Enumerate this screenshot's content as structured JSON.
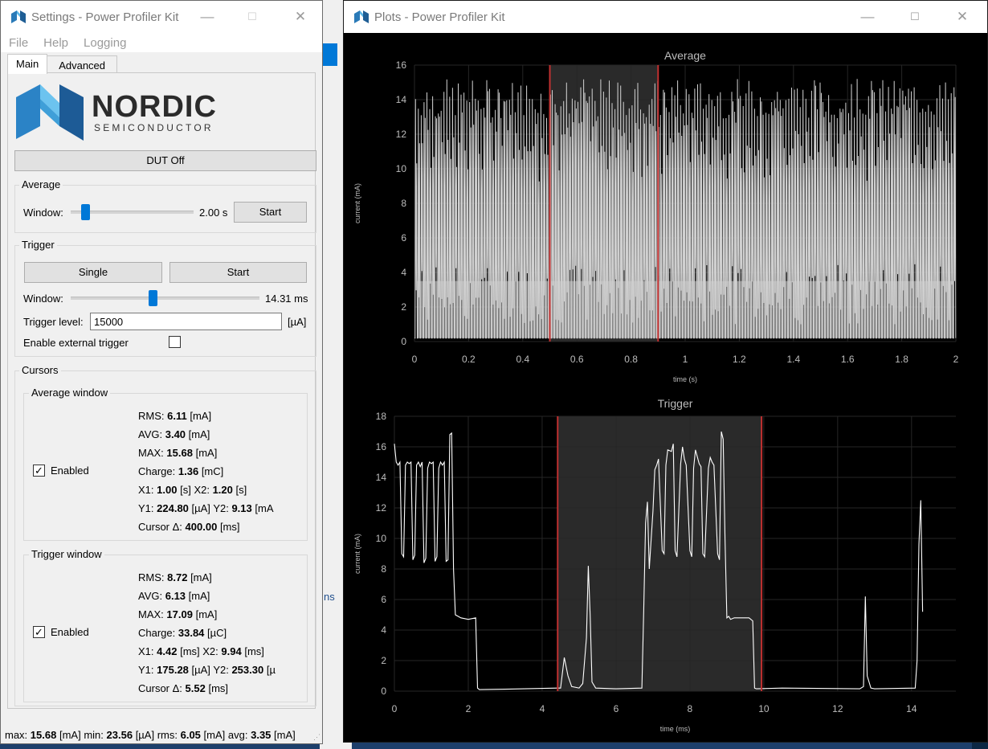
{
  "settings_window": {
    "title": "Settings - Power Profiler Kit",
    "controls": {
      "minimize": "—",
      "maximize": "☐",
      "close": "✕"
    },
    "menu": [
      "File",
      "Help",
      "Logging"
    ],
    "tabs": [
      "Main",
      "Advanced"
    ],
    "logo": {
      "line1": "NORDIC",
      "line2": "SEMICONDUCTOR",
      "color": "#00A9CE"
    },
    "dut_button": "DUT Off",
    "average": {
      "title": "Average",
      "window_label": "Window:",
      "window_value": "2.00 s",
      "start_button": "Start"
    },
    "trigger": {
      "title": "Trigger",
      "single_button": "Single",
      "start_button": "Start",
      "window_label": "Window:",
      "window_value": "14.31 ms",
      "level_label": "Trigger level:",
      "level_value": "15000",
      "level_unit": "[µA]",
      "external_label": "Enable external trigger"
    },
    "cursors": {
      "title": "Cursors",
      "average_window": {
        "title": "Average window",
        "enabled_label": "Enabled",
        "rms": {
          "label": "RMS:",
          "value": "6.11",
          "unit": "[mA]"
        },
        "avg": {
          "label": "AVG:",
          "value": "3.40",
          "unit": "[mA]"
        },
        "max": {
          "label": "MAX:",
          "value": "15.68",
          "unit": "[mA]"
        },
        "charge": {
          "label": "Charge:",
          "value": "1.36",
          "unit": "[mC]"
        },
        "x1": {
          "label": "X1:",
          "value": "1.00",
          "unit": "[s]",
          "label2": "X2:",
          "value2": "1.20",
          "unit2": "[s]"
        },
        "y1": {
          "label": "Y1:",
          "value": "224.80",
          "unit": "[µA]",
          "label2": "Y2:",
          "value2": "9.13",
          "unit2": "[mA"
        },
        "delta": {
          "label": "Cursor Δ:",
          "value": "400.00",
          "unit": "[ms]"
        }
      },
      "trigger_window": {
        "title": "Trigger window",
        "enabled_label": "Enabled",
        "rms": {
          "label": "RMS:",
          "value": "8.72",
          "unit": "[mA]"
        },
        "avg": {
          "label": "AVG:",
          "value": "6.13",
          "unit": "[mA]"
        },
        "max": {
          "label": "MAX:",
          "value": "17.09",
          "unit": "[mA]"
        },
        "charge": {
          "label": "Charge:",
          "value": "33.84",
          "unit": "[µC]"
        },
        "x1": {
          "label": "X1:",
          "value": "4.42",
          "unit": "[ms]",
          "label2": "X2:",
          "value2": "9.94",
          "unit2": "[ms]"
        },
        "y1": {
          "label": "Y1:",
          "value": "175.28",
          "unit": "[µA]",
          "label2": "Y2:",
          "value2": "253.30",
          "unit2": "[µ"
        },
        "delta": {
          "label": "Cursor Δ:",
          "value": "5.52",
          "unit": "[ms]"
        }
      }
    },
    "status": {
      "max_label": "max:",
      "max_value": "15.68",
      "max_unit": "[mA]",
      "min_label": "min:",
      "min_value": "23.56",
      "min_unit": "[µA]",
      "rms_label": "rms:",
      "rms_value": "6.05",
      "rms_unit": "[mA]",
      "avg_label": "avg:",
      "avg_value": "3.35",
      "avg_unit": "[mA]"
    }
  },
  "plots_window": {
    "title": "Plots - Power Profiler Kit",
    "controls": {
      "minimize": "—",
      "maximize": "☐",
      "close": "✕"
    }
  },
  "background": {
    "text": "ns"
  },
  "chart_data": [
    {
      "type": "line",
      "title": "Average",
      "xlabel": "time (s)",
      "ylabel": "current (mA)",
      "xlim": [
        0,
        2
      ],
      "ylim": [
        0,
        16
      ],
      "xticks": [
        0,
        0.2,
        0.4,
        0.6,
        0.8,
        1,
        1.2,
        1.4,
        1.6,
        1.8,
        2
      ],
      "yticks": [
        0,
        2,
        4,
        6,
        8,
        10,
        12,
        14,
        16
      ],
      "grid": true,
      "series_color": "#d0d0d0",
      "cursor_color": "#c03030",
      "cursors": [
        0.5,
        0.9
      ],
      "signal": {
        "baseline": 0.2,
        "peak": 15.2,
        "pulses_approx": 190
      }
    },
    {
      "type": "line",
      "title": "Trigger",
      "xlabel": "time (ms)",
      "ylabel": "current (mA)",
      "xlim": [
        0,
        15.2
      ],
      "ylim": [
        0,
        18
      ],
      "xticks": [
        0,
        2,
        4,
        6,
        8,
        10,
        12,
        14
      ],
      "yticks": [
        0,
        2,
        4,
        6,
        8,
        10,
        12,
        14,
        16,
        18
      ],
      "grid": true,
      "series_color": "#ffffff",
      "cursor_color": "#c03030",
      "cursors": [
        4.42,
        9.94
      ],
      "x": [
        0,
        0.05,
        0.1,
        0.15,
        0.2,
        0.25,
        0.3,
        0.35,
        0.4,
        0.45,
        0.5,
        0.55,
        0.6,
        0.65,
        0.7,
        0.75,
        0.8,
        0.85,
        0.9,
        0.95,
        1.0,
        1.05,
        1.1,
        1.15,
        1.2,
        1.25,
        1.3,
        1.35,
        1.4,
        1.45,
        1.5,
        1.55,
        1.6,
        1.65,
        1.8,
        2.0,
        2.2,
        2.25,
        2.3,
        3.5,
        4.4,
        4.5,
        4.6,
        4.7,
        4.8,
        5.0,
        5.1,
        5.2,
        5.25,
        5.3,
        5.35,
        5.45,
        6.0,
        6.7,
        6.75,
        6.8,
        6.85,
        6.9,
        7.0,
        7.05,
        7.1,
        7.15,
        7.25,
        7.3,
        7.35,
        7.4,
        7.5,
        7.55,
        7.6,
        7.65,
        7.75,
        7.8,
        7.85,
        7.9,
        8.0,
        8.05,
        8.1,
        8.15,
        8.25,
        8.3,
        8.35,
        8.4,
        8.5,
        8.55,
        8.6,
        8.65,
        8.75,
        8.8,
        8.85,
        8.9,
        8.95,
        9.0,
        9.05,
        9.1,
        9.2,
        9.6,
        9.7,
        9.75,
        9.8,
        10.5,
        12.6,
        12.7,
        12.75,
        12.8,
        12.9,
        13.0,
        14.1,
        14.15,
        14.2,
        14.25,
        14.3
      ],
      "y": [
        16.2,
        15.0,
        14.8,
        15.0,
        9.0,
        8.8,
        14.8,
        15.0,
        14.9,
        15.0,
        8.6,
        8.9,
        14.8,
        15.0,
        14.7,
        15.0,
        8.4,
        8.7,
        14.6,
        15.0,
        14.9,
        15.0,
        8.5,
        8.8,
        14.6,
        15.0,
        14.8,
        15.0,
        8.5,
        8.6,
        16.8,
        16.9,
        8.0,
        5.0,
        4.8,
        4.7,
        4.8,
        0.2,
        0.1,
        0.15,
        0.2,
        0.2,
        2.2,
        1.0,
        0.3,
        0.2,
        0.5,
        3.5,
        8.2,
        5.0,
        0.6,
        0.2,
        0.15,
        0.2,
        5.3,
        11.0,
        12.4,
        8.0,
        11.8,
        14.5,
        14.8,
        15.2,
        9.2,
        9.0,
        14.8,
        15.8,
        15.7,
        16.2,
        9.2,
        8.8,
        14.9,
        16.0,
        15.2,
        14.8,
        9.2,
        8.8,
        14.6,
        15.8,
        14.9,
        14.7,
        9.0,
        8.8,
        14.6,
        15.3,
        15.0,
        14.8,
        9.0,
        8.6,
        17.0,
        16.5,
        10.0,
        4.8,
        4.9,
        4.7,
        4.8,
        4.8,
        4.6,
        0.2,
        0.15,
        0.2,
        0.15,
        0.3,
        6.2,
        1.0,
        0.2,
        0.15,
        0.2,
        2.0,
        9.6,
        12.5,
        5.2
      ]
    }
  ]
}
